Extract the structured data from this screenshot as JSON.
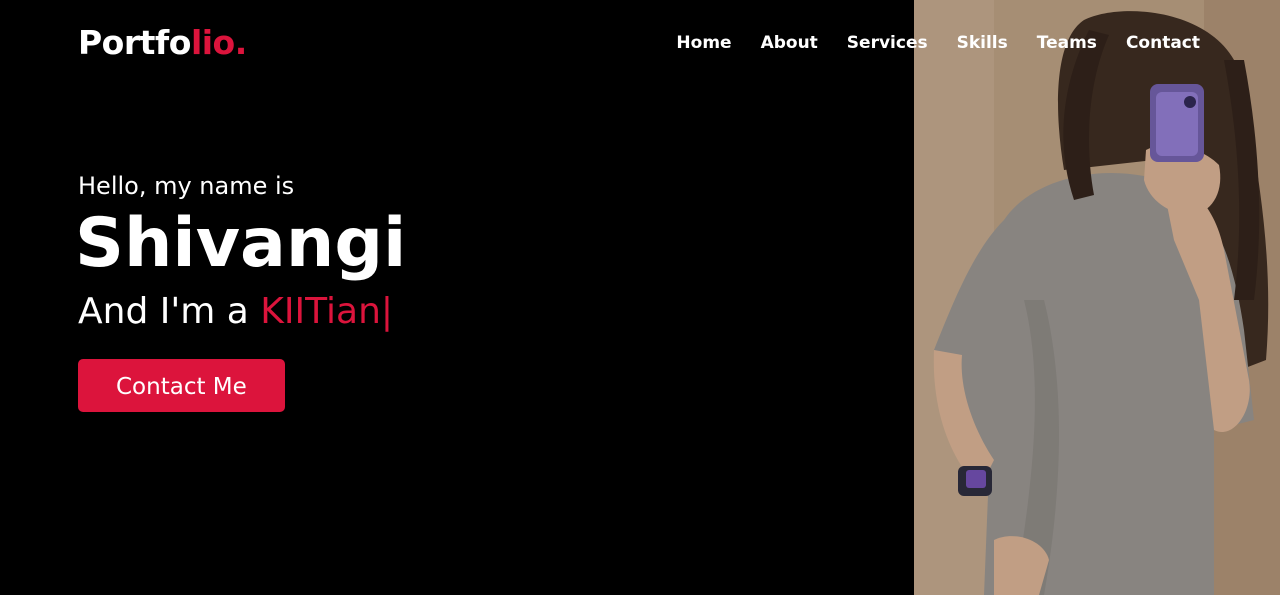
{
  "navbar": {
    "logo": {
      "main": "Portfo",
      "accent": "lio."
    },
    "menu": [
      {
        "label": "Home"
      },
      {
        "label": "About"
      },
      {
        "label": "Services"
      },
      {
        "label": "Skills"
      },
      {
        "label": "Teams"
      },
      {
        "label": "Contact"
      }
    ]
  },
  "hero": {
    "greeting": "Hello, my name is",
    "name": "Shivangi",
    "role_prefix": "And I'm a ",
    "role_typed": "KIITian",
    "cursor": "|",
    "button_label": "Contact Me"
  },
  "colors": {
    "background": "#000000",
    "accent": "#dc143c",
    "text": "#ffffff"
  }
}
